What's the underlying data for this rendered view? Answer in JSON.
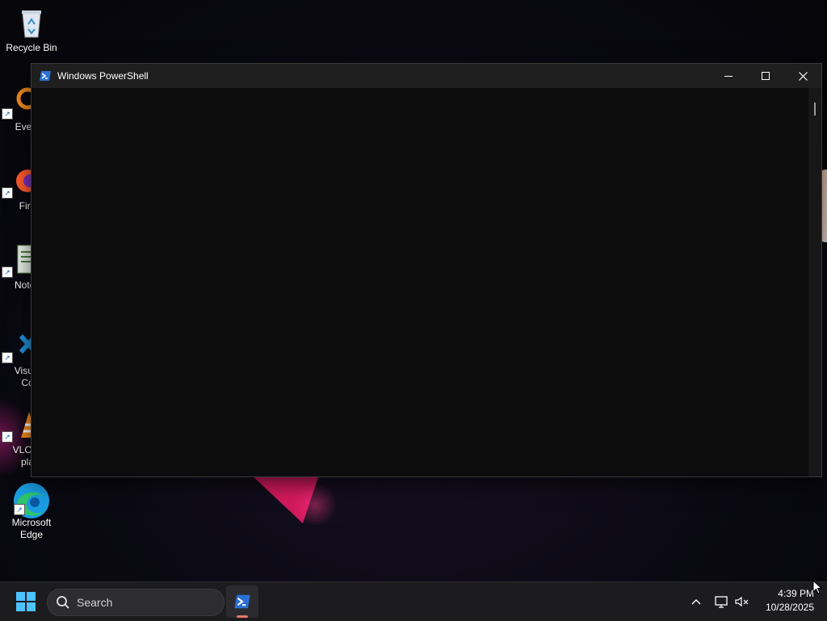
{
  "desktop": {
    "icons": [
      {
        "label": "Recycle Bin"
      },
      {
        "label": "Every"
      },
      {
        "label": "Fire"
      },
      {
        "label": "Notep"
      },
      {
        "label": "Visual\nCo"
      },
      {
        "label": "VLC m\npla"
      },
      {
        "label": "Microsoft\nEdge"
      }
    ]
  },
  "window": {
    "title": "Windows PowerShell",
    "controls": {
      "minimize": "minimize",
      "maximize": "maximize",
      "close": "close"
    }
  },
  "taskbar": {
    "search_placeholder": "Search",
    "pinned_apps": [
      {
        "name": "Windows PowerShell",
        "icon": "powershell-icon",
        "active": true
      }
    ],
    "clock": {
      "time": "4:39 PM",
      "date": "10/28/2025"
    }
  },
  "colors": {
    "terminal_bg": "#0c0c0c",
    "titlebar_bg": "#1f1f1f",
    "taskbar_bg": "#1c1c1f",
    "accent_indicator": "#e8776b",
    "powershell_blue": "#2a6fd4"
  }
}
